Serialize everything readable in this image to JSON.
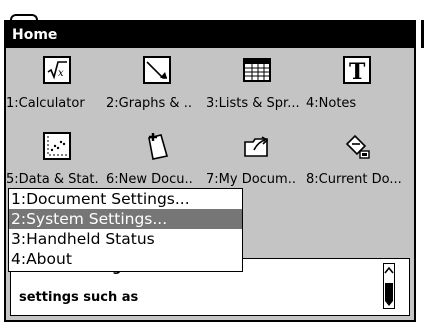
{
  "window": {
    "title": "Home"
  },
  "apps_row1": [
    {
      "label": "1:Calculator",
      "icon": "calculator-icon"
    },
    {
      "label": "2:Graphs & ..",
      "icon": "graphs-icon"
    },
    {
      "label": "3:Lists & Spr...",
      "icon": "lists-spreadsheet-icon"
    },
    {
      "label": "4:Notes",
      "icon": "notes-icon"
    }
  ],
  "apps_row2": [
    {
      "label": "5:Data & Stat.",
      "icon": "data-stat-icon"
    },
    {
      "label": "6:New Docu..",
      "icon": "new-document-icon"
    },
    {
      "label": "7:My Docum..",
      "icon": "my-documents-icon"
    },
    {
      "label": "8:Current Do...",
      "icon": "current-document-icon"
    }
  ],
  "menu": {
    "items": [
      {
        "label": "1:Document Settings...",
        "selected": false
      },
      {
        "label": "2:System Settings...",
        "selected": true
      },
      {
        "label": "3:Handheld Status",
        "selected": false
      },
      {
        "label": "4:About",
        "selected": false
      }
    ]
  },
  "description": {
    "line1": "view or change",
    "line2": "settings such as"
  },
  "colors": {
    "window_bg": "#c4c4c4",
    "titlebar": "#000000",
    "selection": "#767676"
  }
}
